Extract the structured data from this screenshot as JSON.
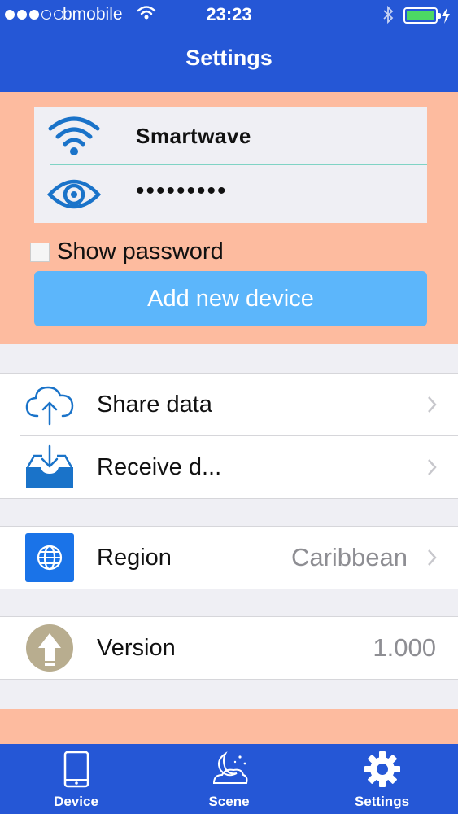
{
  "status_bar": {
    "carrier": "bmobile",
    "time": "23:23",
    "signal_bars_filled": 3,
    "signal_bars_total": 5,
    "battery_level": 1.0,
    "battery_color": "#4cd964"
  },
  "nav": {
    "title": "Settings",
    "bar_color": "#2557d6"
  },
  "credentials": {
    "network_name": "Smartwave",
    "password_masked": "•••••••••",
    "wifi_icon": "wifi-icon",
    "password_icon": "eye-icon",
    "show_password_label": "Show password",
    "show_password_checked": false,
    "add_device_label": "Add new device",
    "panel_color": "#fdbb9f",
    "button_color": "#5cb6fb"
  },
  "list": {
    "share": {
      "label": "Share data",
      "icon": "cloud-upload-icon"
    },
    "receive": {
      "label": "Receive d...",
      "icon": "inbox-download-icon"
    },
    "region": {
      "label": "Region",
      "value": "Caribbean",
      "icon": "globe-icon"
    },
    "version": {
      "label": "Version",
      "value": "1.000",
      "icon": "upgrade-arrow-icon"
    }
  },
  "tabs": [
    {
      "label": "Device",
      "icon": "phone-icon"
    },
    {
      "label": "Scene",
      "icon": "scene-moon-icon"
    },
    {
      "label": "Settings",
      "icon": "gear-icon",
      "selected": true
    }
  ]
}
